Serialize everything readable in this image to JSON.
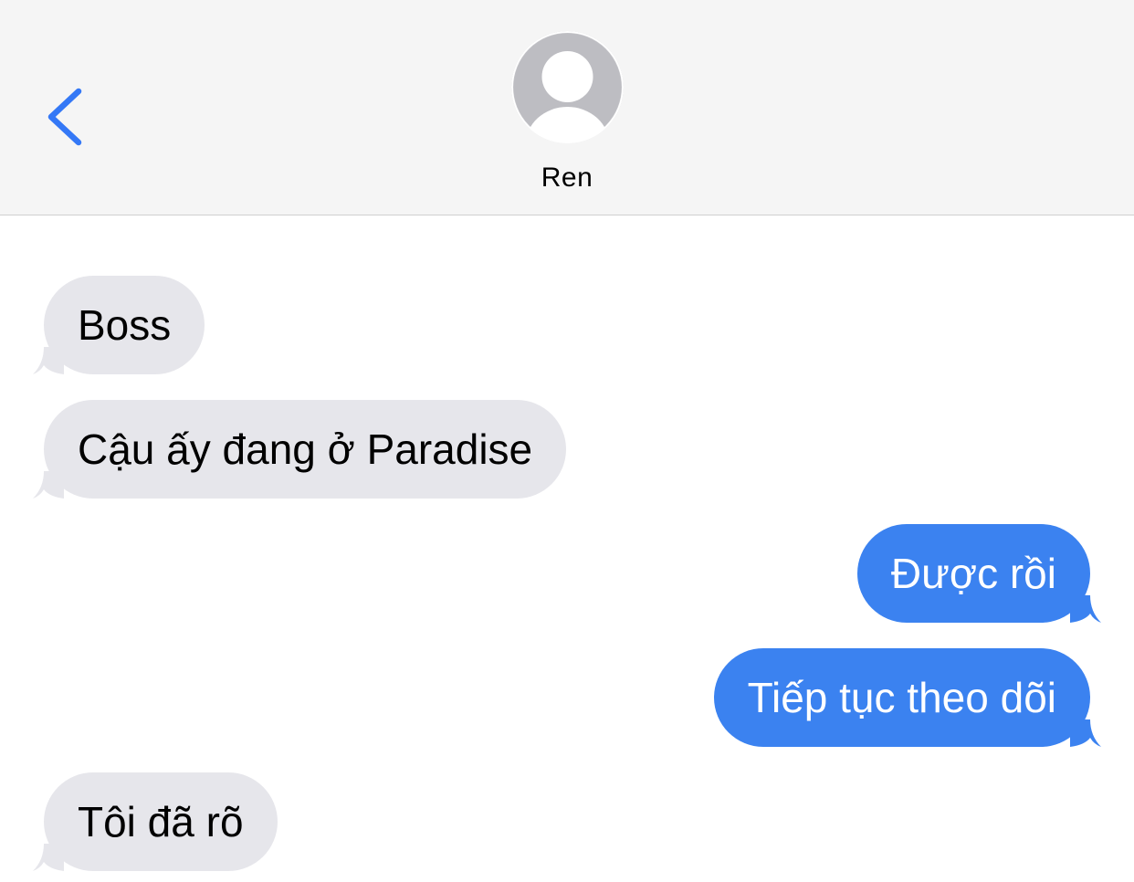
{
  "colors": {
    "incoming_bubble": "#e6e6eb",
    "outgoing_bubble": "#3b82f0",
    "accent": "#3478f6",
    "header_bg": "#f5f5f5"
  },
  "header": {
    "back_icon": "chevron-left-icon",
    "avatar_icon": "person-silhouette-icon",
    "contact_name": "Ren"
  },
  "messages": [
    {
      "direction": "incoming",
      "text": "Boss"
    },
    {
      "direction": "incoming",
      "text": "Cậu ấy đang ở Paradise"
    },
    {
      "direction": "outgoing",
      "text": "Được rồi"
    },
    {
      "direction": "outgoing",
      "text": "Tiếp tục theo dõi"
    },
    {
      "direction": "incoming",
      "text": "Tôi đã rõ"
    }
  ]
}
